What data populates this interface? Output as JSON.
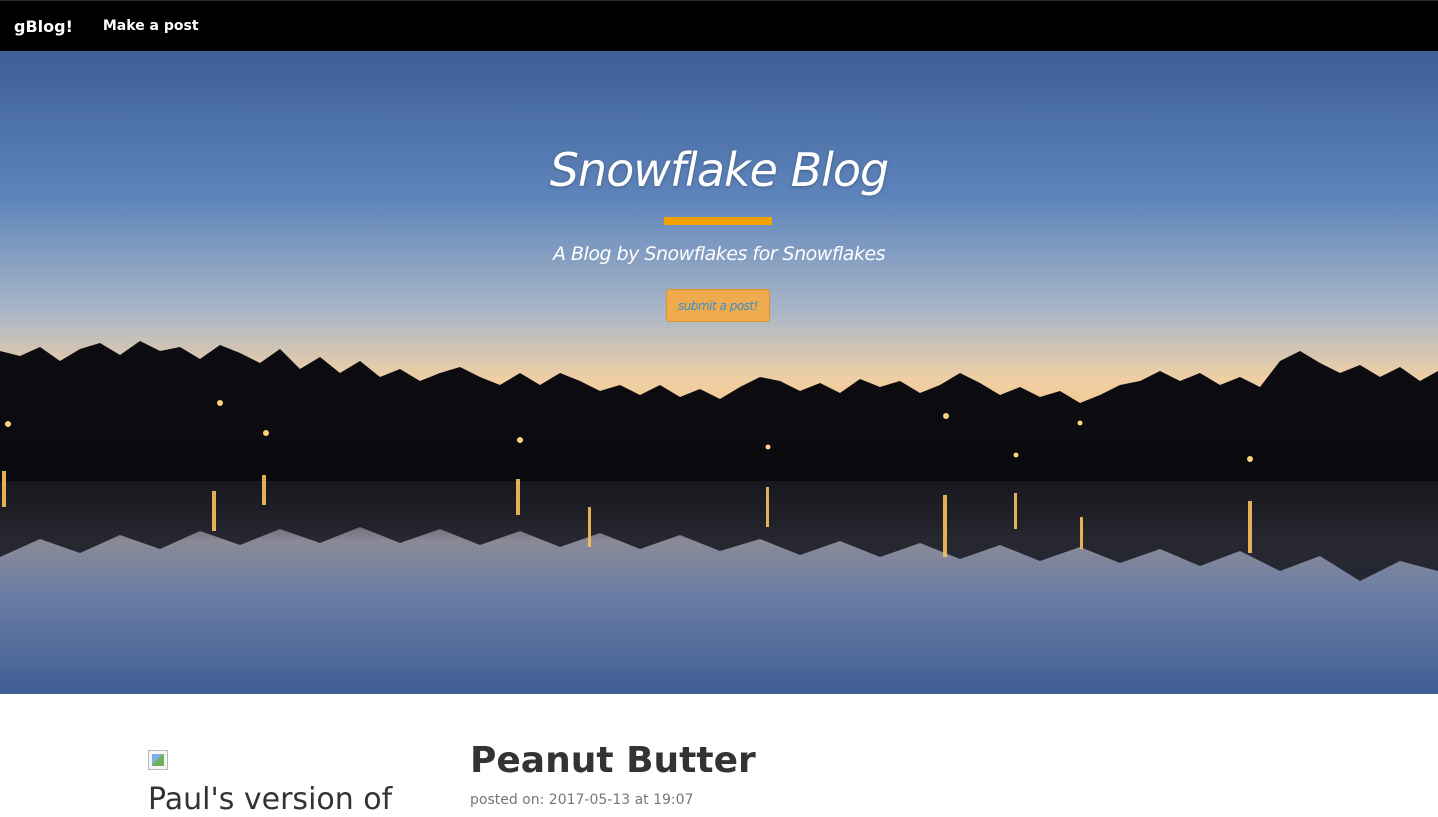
{
  "navbar": {
    "brand": "gBlog!",
    "make_post": "Make a post"
  },
  "hero": {
    "title": "Snowflake Blog",
    "subtitle": "A Blog by Snowflakes for Snowflakes",
    "button_label": "submit a post!",
    "accent_color": "#f5a200"
  },
  "posts": {
    "side_title": "Paul's version of",
    "main_title": "Peanut Butter",
    "main_meta": "posted on: 2017-05-13 at 19:07"
  }
}
